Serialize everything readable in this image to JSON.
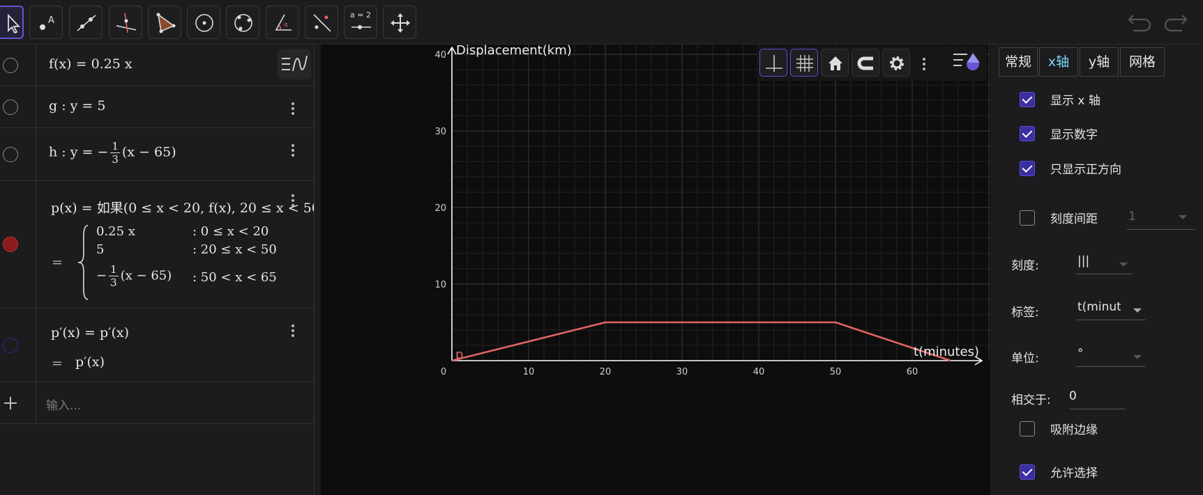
{
  "toolbar": {
    "tools": [
      {
        "id": "move",
        "icon": "pointer-icon"
      },
      {
        "id": "point",
        "icon": "point-icon"
      },
      {
        "id": "line",
        "icon": "line-icon"
      },
      {
        "id": "perpendicular",
        "icon": "perpendicular-line-icon"
      },
      {
        "id": "polygon",
        "icon": "polygon-icon"
      },
      {
        "id": "circle",
        "icon": "circle-center-point-icon"
      },
      {
        "id": "circle3",
        "icon": "circle-three-points-icon"
      },
      {
        "id": "angle",
        "icon": "angle-icon"
      },
      {
        "id": "reflect",
        "icon": "reflect-line-icon"
      },
      {
        "id": "slider",
        "icon": "slider-icon",
        "label": "a = 2"
      },
      {
        "id": "move-view",
        "icon": "move-graphics-view-icon"
      }
    ],
    "active": "move"
  },
  "algebra": {
    "f": {
      "lhs": "f(x)",
      "rhs": "0.25 x"
    },
    "g": {
      "text": "g : y = 5"
    },
    "h": {
      "prefix": "h : y = −",
      "num": "1",
      "den": "3",
      "suffix": "(x − 65)"
    },
    "p": {
      "definition": "p(x) = 如果(0 ≤ x < 20, f(x), 20 ≤ x < 50",
      "eq": "=",
      "cases": [
        {
          "expr": "0.25 x",
          "cond": ": 0 ≤ x < 20"
        },
        {
          "expr": "5",
          "cond": ": 20 ≤ x < 50"
        },
        {
          "expr_prefix": "−",
          "num": "1",
          "den": "3",
          "expr_suffix": "(x − 65)",
          "cond": ": 50 < x < 65"
        }
      ]
    },
    "pprime": {
      "definition": "p′(x) = p′(x)",
      "eq": "=",
      "value": "p′(x)"
    },
    "input_placeholder": "输入..."
  },
  "graphics": {
    "xlabel": "t(minutes)",
    "ylabel": "Displacement(km)",
    "point_label": "p",
    "colors": {
      "curve": "#e06464",
      "axis": "#ffffff",
      "grid_major": "#3a3a3a",
      "grid_minor": "#222222"
    }
  },
  "chart_data": {
    "type": "line",
    "series": [
      {
        "name": "p",
        "x": [
          0,
          20,
          50,
          65
        ],
        "y": [
          0,
          5,
          5,
          0
        ]
      }
    ],
    "x_ticks": [
      0,
      10,
      20,
      30,
      40,
      50,
      60
    ],
    "y_ticks": [
      10,
      20,
      30,
      40
    ],
    "xlim": [
      -1,
      70
    ],
    "ylim": [
      0,
      40
    ],
    "xlabel": "t(minutes)",
    "ylabel": "Displacement(km)",
    "grid": true
  },
  "properties": {
    "tabs": [
      "常规",
      "x轴",
      "y轴",
      "网格"
    ],
    "active_tab": "x轴",
    "show_x_axis": {
      "label": "显示 x 轴",
      "checked": true
    },
    "show_numbers": {
      "label": "显示数字",
      "checked": true
    },
    "positive_only": {
      "label": "只显示正方向",
      "checked": true
    },
    "tick_distance": {
      "label": "刻度间距",
      "checked": false,
      "value": "1"
    },
    "ticks": {
      "label": "刻度:",
      "value": "|||"
    },
    "axis_label": {
      "label": "标签:",
      "value": "t(minutes)"
    },
    "unit": {
      "label": "单位:",
      "value": "°"
    },
    "crossing": {
      "label": "相交于:",
      "value": "0"
    },
    "snap_edge": {
      "label": "吸附边缘",
      "checked": false
    },
    "allow_selection": {
      "label": "允许选择",
      "checked": true
    }
  }
}
